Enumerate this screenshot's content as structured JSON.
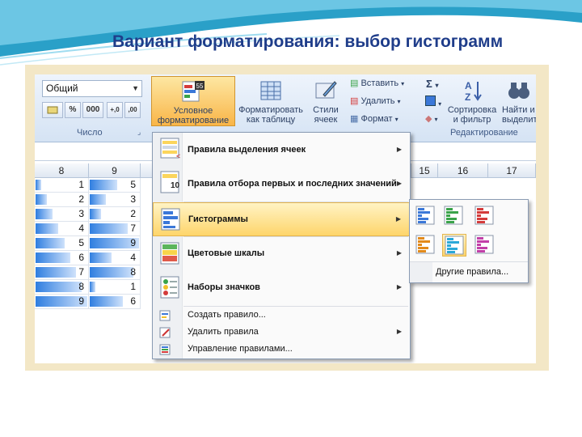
{
  "slide": {
    "title": "Вариант форматирования: выбор гистограмм"
  },
  "ribbon": {
    "number_format": "Общий",
    "num_buttons": [
      "%",
      "000",
      "+,0",
      ",00"
    ],
    "groups": {
      "number": "Число",
      "editing": "Редактирование"
    },
    "conditional_formatting": "Условное форматирование",
    "format_as_table": "Форматировать как таблицу",
    "cell_styles": "Стили ячеек",
    "insert": "Вставить",
    "delete": "Удалить",
    "format": "Формат",
    "sort_filter": "Сортировка и фильтр",
    "find_select": "Найти и выделить",
    "sum_symbol": "Σ"
  },
  "columns": [
    "8",
    "9",
    "15",
    "16",
    "17"
  ],
  "col8_values": [
    "1",
    "2",
    "3",
    "4",
    "5",
    "6",
    "7",
    "8",
    "9"
  ],
  "col9_values": [
    "5",
    "3",
    "2",
    "7",
    "9",
    "4",
    "8",
    "1",
    "6"
  ],
  "menu": {
    "items": [
      {
        "label": "Правила выделения ячеек",
        "bold": true
      },
      {
        "label": "Правила отбора первых и последних значений",
        "bold": true
      },
      {
        "label": "Гистограммы",
        "bold": true
      },
      {
        "label": "Цветовые шкалы",
        "bold": true
      },
      {
        "label": "Наборы значков",
        "bold": true
      },
      {
        "label": "Создать правило...",
        "bold": false
      },
      {
        "label": "Удалить правила",
        "bold": false
      },
      {
        "label": "Управление правилами...",
        "bold": false
      }
    ],
    "top10_icon_text": "10"
  },
  "submenu": {
    "more_rules": "Другие правила...",
    "tile_colors": [
      "#3b78d8",
      "#3aa34a",
      "#d43b3b",
      "#e38a1a",
      "#2aa8d8",
      "#c23fa8"
    ]
  }
}
